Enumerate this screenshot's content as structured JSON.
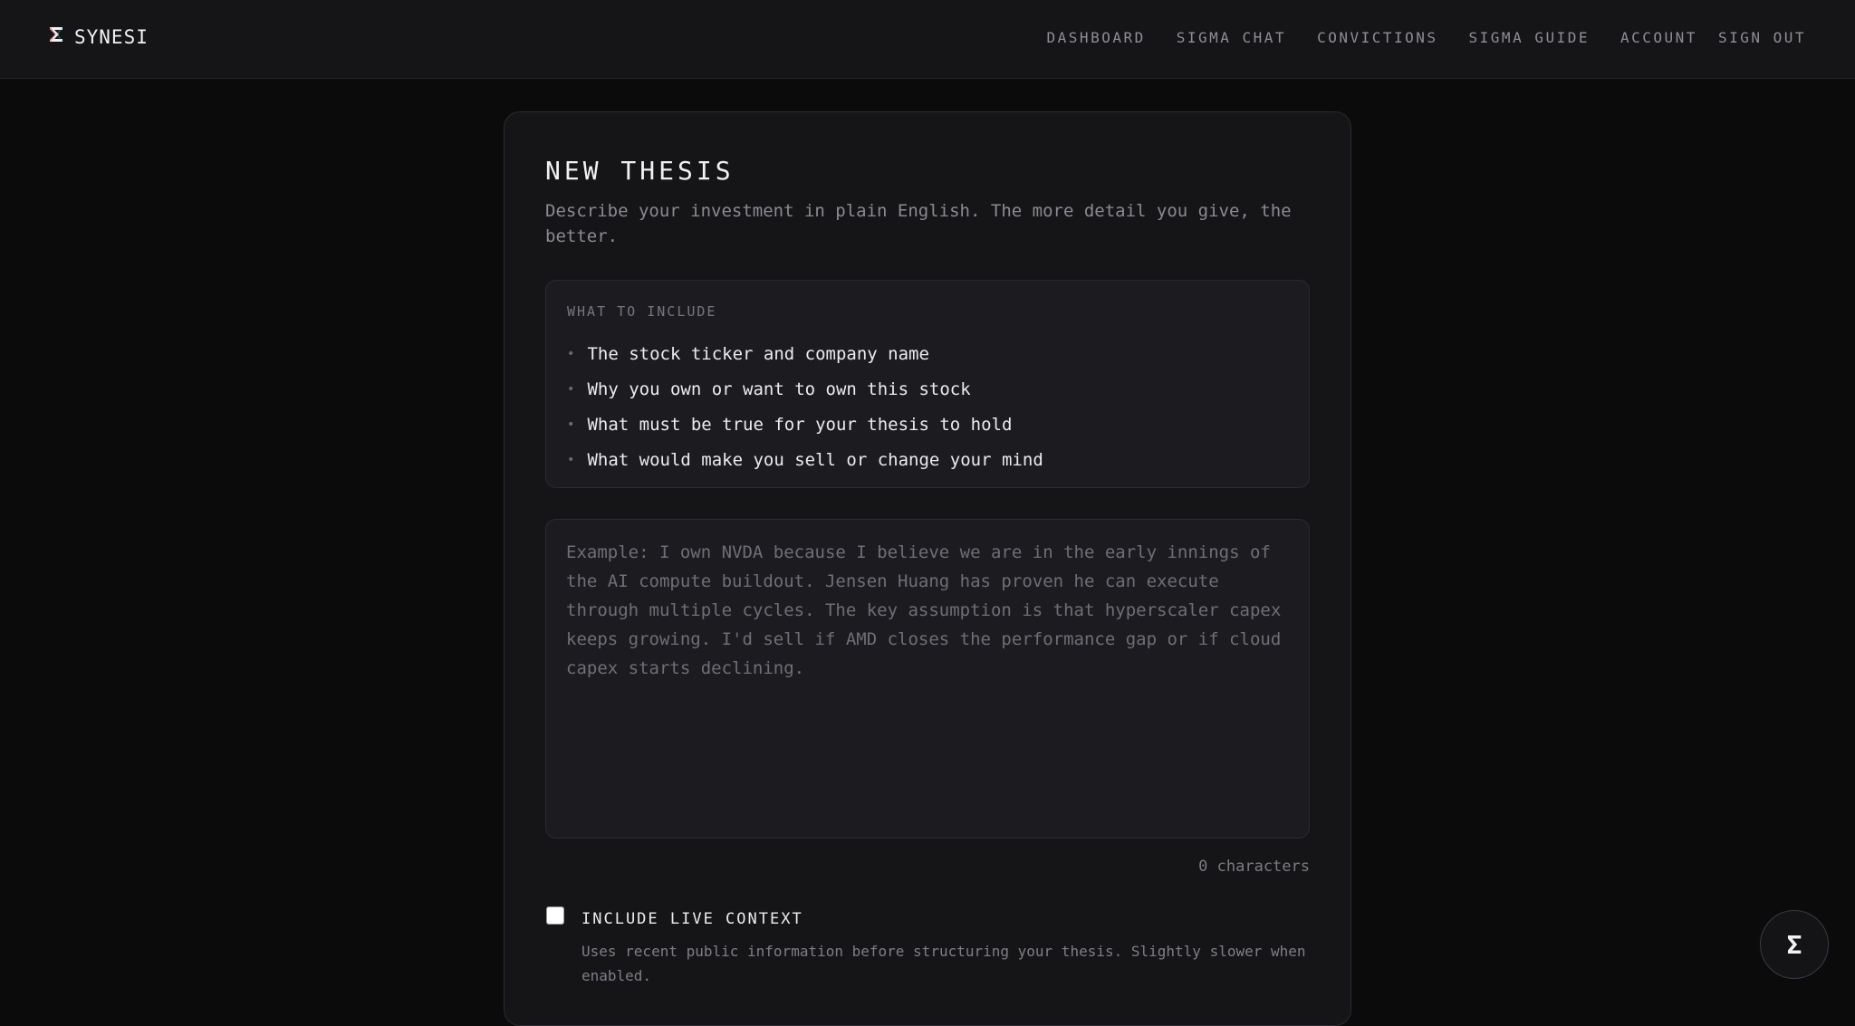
{
  "brand": {
    "icon": "sigma-logo-icon",
    "name": "SYNESI"
  },
  "nav": {
    "dashboard": "DASHBOARD",
    "sigma_chat": "SIGMA CHAT",
    "convictions": "CONVICTIONS",
    "sigma_guide": "SIGMA GUIDE",
    "account": "ACCOUNT",
    "sign_out": "SIGN OUT"
  },
  "form": {
    "title": "NEW THESIS",
    "subtitle": "Describe your investment in plain English. The more detail you give, the better.",
    "include": {
      "heading": "WHAT TO INCLUDE",
      "items": [
        "The stock ticker and company name",
        "Why you own or want to own this stock",
        "What must be true for your thesis to hold",
        "What would make you sell or change your mind"
      ]
    },
    "thesis_input": {
      "value": "",
      "placeholder": "Example: I own NVDA because I believe we are in the early innings of the AI compute buildout. Jensen Huang has proven he can execute through multiple cycles. The key assumption is that hyperscaler capex keeps growing. I'd sell if AMD closes the performance gap or if cloud capex starts declining."
    },
    "char_count": "0 characters",
    "live_context": {
      "checked": false,
      "label": "INCLUDE LIVE CONTEXT",
      "description": "Uses recent public information before structuring your thesis. Slightly slower when enabled."
    }
  },
  "fab": {
    "icon": "sigma-icon",
    "glyph": "Σ"
  },
  "colors": {
    "background": "#0b0b0c",
    "surface": "#151518",
    "panel": "#1c1c20",
    "muted_text": "#8a8a92"
  }
}
